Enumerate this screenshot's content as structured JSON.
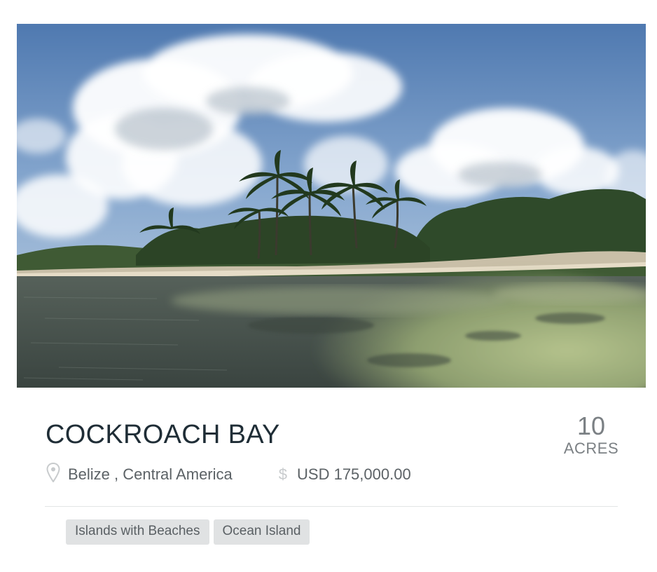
{
  "listing": {
    "image_alt": "Tropical island shoreline with palm trees",
    "title": "COCKROACH BAY",
    "location": "Belize , Central America",
    "price": "USD 175,000.00",
    "area_value": "10",
    "area_unit": "ACRES",
    "tags": [
      "Islands with Beaches",
      "Ocean Island"
    ]
  },
  "icons": {
    "location": "map-pin-icon",
    "price": "dollar-icon"
  },
  "colors": {
    "title": "#1f2d36",
    "meta_text": "#5c6266",
    "icon": "#c8cbcd",
    "tag_bg": "#e0e2e3"
  }
}
